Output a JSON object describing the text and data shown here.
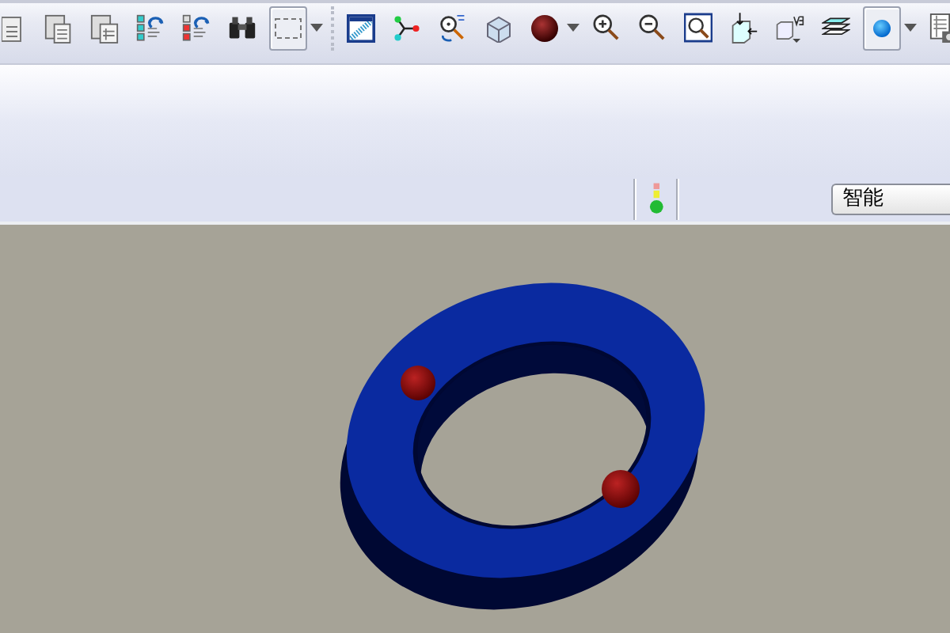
{
  "toolbar": {
    "buttons": [
      {
        "pressed": false
      },
      {
        "pressed": false
      },
      {
        "pressed": false
      },
      {
        "pressed": false
      },
      {
        "pressed": false
      },
      {
        "pressed": false
      },
      {
        "pressed": true
      },
      {
        "pressed": false
      },
      {
        "pressed": false
      },
      {
        "pressed": false
      },
      {
        "pressed": false
      },
      {
        "pressed": false
      },
      {
        "pressed": false
      },
      {
        "pressed": false
      },
      {
        "pressed": false
      },
      {
        "pressed": false
      },
      {
        "pressed": false
      },
      {
        "pressed": false
      },
      {
        "pressed": true
      },
      {
        "pressed": false
      }
    ]
  },
  "status_bar": {
    "selection_filter": {
      "value": "智能"
    }
  }
}
